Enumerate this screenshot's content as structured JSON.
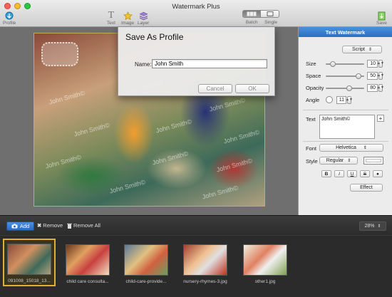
{
  "window": {
    "title": "Watermark Plus"
  },
  "toolbar": {
    "profile_label": "Profile",
    "text_label": "Text",
    "image_label": "Image",
    "layer_label": "Layer",
    "batch_label": "Batch",
    "single_label": "Single",
    "save_label": "Save"
  },
  "watermark_text": "John Smith©",
  "dialog": {
    "title": "Save As Profile",
    "name_label": "Name:",
    "name_value": "John Smith",
    "cancel_label": "Cancel",
    "ok_label": "OK"
  },
  "panel": {
    "header": "Text Watermark",
    "mode": "Script",
    "size_label": "Size",
    "size_value": "10",
    "space_label": "Space",
    "space_value": "50",
    "opacity_label": "Opacity",
    "opacity_value": "80",
    "angle_label": "Angle",
    "angle_value": "11",
    "text_label": "Text",
    "text_value": "John Smith©",
    "add_symbol": "+",
    "font_label": "Font",
    "font_value": "Helvetica",
    "style_label": "Style",
    "style_value": "Regular",
    "format_buttons": [
      "B",
      "I",
      "U",
      "S",
      "●"
    ],
    "effect_label": "Effect"
  },
  "bottom": {
    "add_label": "Add",
    "remove_label": "Remove",
    "remove_all_label": "Remove All",
    "zoom_value": "28%"
  },
  "thumbnails": [
    {
      "caption": "091008_15018_13...",
      "selected": true
    },
    {
      "caption": "child care consulta..."
    },
    {
      "caption": "child-care-provide..."
    },
    {
      "caption": "nursery-rhymes-3.jpg"
    },
    {
      "caption": "other1.jpg"
    }
  ],
  "colors": {
    "accent": "#2a6fc4",
    "selection": "#e0b030"
  }
}
